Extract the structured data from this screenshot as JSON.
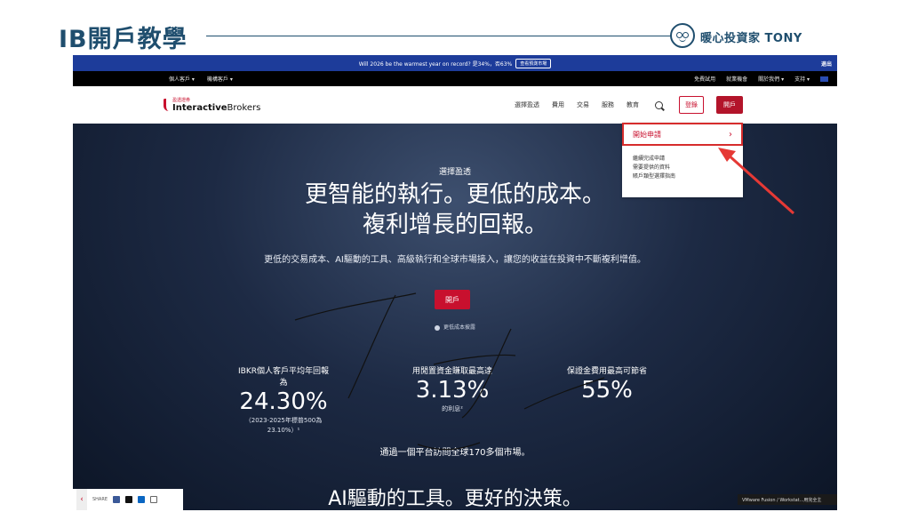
{
  "slide": {
    "title": "IB開戶教學",
    "brand": "暖心投資家 TONY"
  },
  "banner": {
    "text": "Will 2026 be the warmest year on record? 是34%，否63%",
    "button": "查看預測市場",
    "exit": "退出"
  },
  "topbar": {
    "left": [
      "個人客戶 ▾",
      "機構客戶 ▾"
    ],
    "right": [
      "免費試用",
      "就業機會",
      "關於我們 ▾",
      "支持 ▾"
    ]
  },
  "nav": {
    "logo_cn": "盈透證券",
    "logo_bold": "Interactive",
    "logo_rest": "Brokers",
    "menu": [
      "選擇盈透",
      "費用",
      "交易",
      "服務",
      "教育"
    ],
    "login": "登錄",
    "open_account": "開戶"
  },
  "dropdown": {
    "primary": "開始申請",
    "items": [
      "繼續完成申請",
      "需要提供的資料",
      "賬戶類型選擇指南"
    ]
  },
  "hero": {
    "kicker": "選擇盈透",
    "headline_1": "更智能的執行。更低的成本。",
    "headline_2": "複利增長的回報。",
    "subtext": "更低的交易成本、AI驅動的工具、高級執行和全球市場接入，讓您的收益在投資中不斷複利增值。",
    "button": "開戶",
    "more_link": "更低成本披露"
  },
  "stats": [
    {
      "label": "IBKR個人客戶平均年回報為",
      "value": "24.30%",
      "note": "（2023-2025年標普500為23.10%）¹"
    },
    {
      "label": "用閒置資金賺取最高達",
      "value": "3.13%",
      "note": "的利息²"
    },
    {
      "label": "保證金費用最高可節省",
      "value": "55%",
      "note": ""
    }
  ],
  "access": "通過一個平台訪問全球170多個市場。",
  "ai_heading": "AI驅動的工具。更好的決策。",
  "share": {
    "label": "SHARE"
  },
  "vm_bar": "VMware Fusion / Workstat...用完全主"
}
